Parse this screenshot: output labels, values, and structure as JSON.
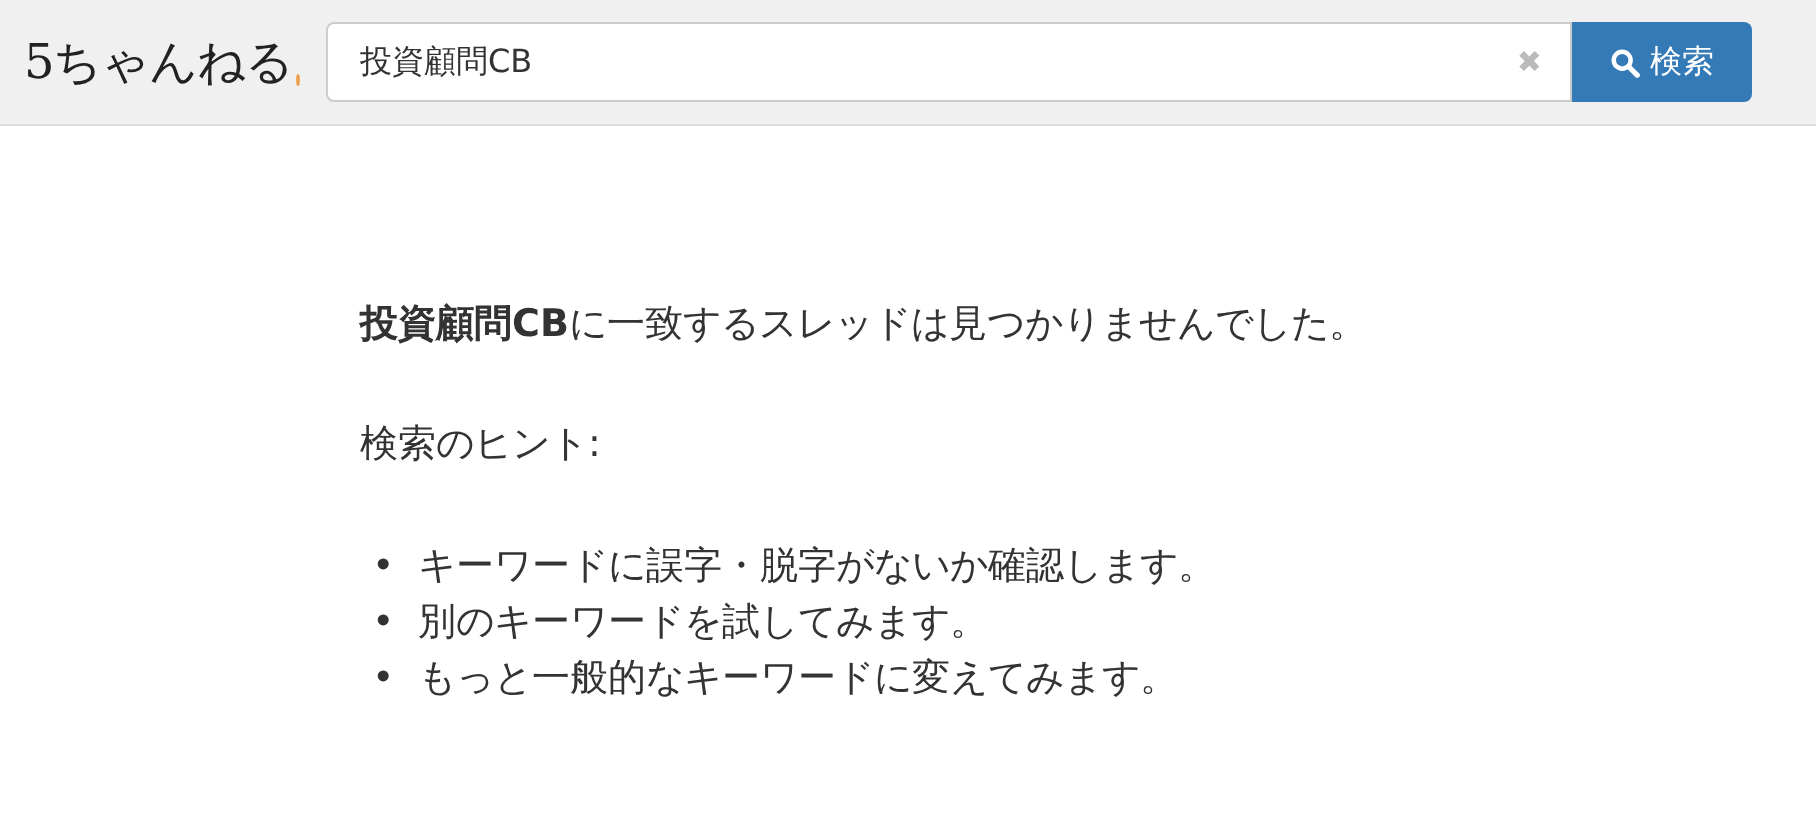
{
  "header": {
    "logo": "5ちゃんねる",
    "search": {
      "value": "投資顧問CB",
      "clear": "✖",
      "button": "検索"
    }
  },
  "result": {
    "message": "**投資顧問CB**に一致するスレッドは見つかりませんでした。",
    "hint_title": "検索のヒント:",
    "hints": [
      {
        "bullet": "•",
        "text": "キーワードに誤字・脱字がないか確認します。"
      },
      {
        "bullet": "•",
        "text": "別のキーワードを試してみます。"
      },
      {
        "bullet": "•",
        "text": "もっと一般的なキーワードに変えてみます。"
      }
    ]
  }
}
